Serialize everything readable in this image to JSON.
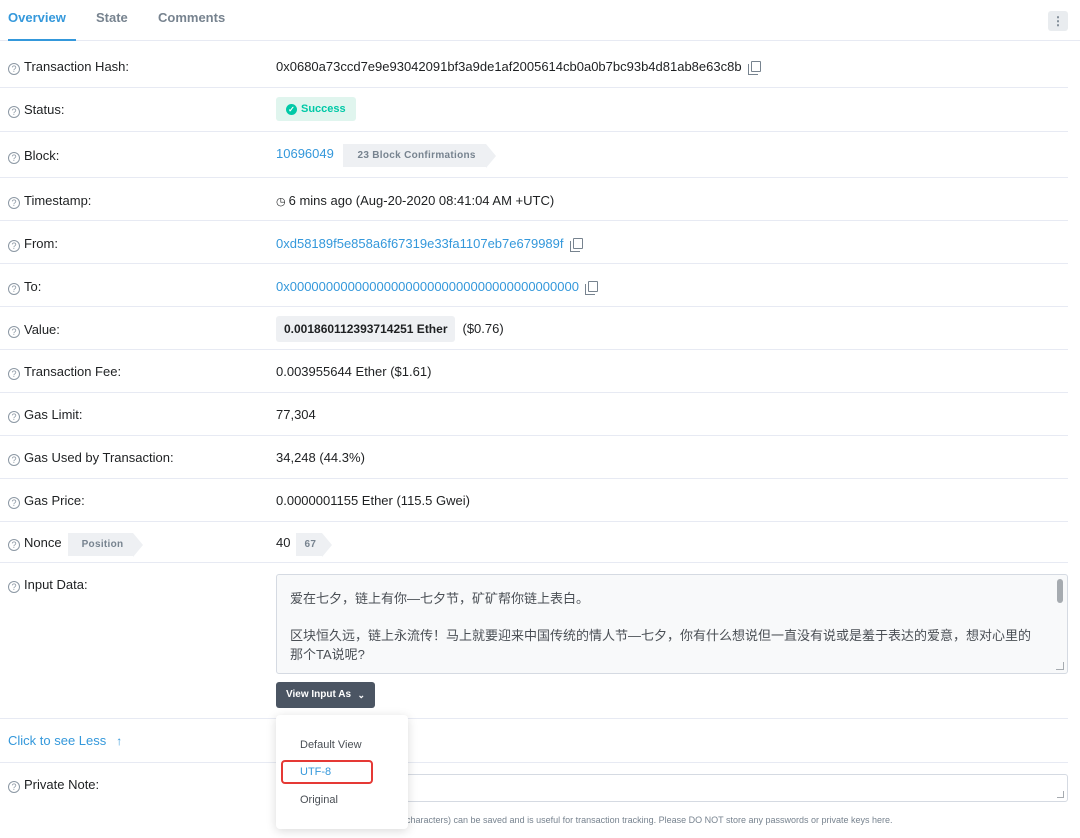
{
  "tabs": {
    "overview": "Overview",
    "state": "State",
    "comments": "Comments",
    "more": "⋮"
  },
  "rows": {
    "hash": {
      "label": "Transaction Hash:",
      "value": "0x0680a73ccd7e9e93042091bf3a9de1af2005614cb0a0b7bc93b4d81ab8e63c8b"
    },
    "status": {
      "label": "Status:",
      "value": "Success"
    },
    "block": {
      "label": "Block:",
      "value": "10696049",
      "confirmations": "23 Block Confirmations"
    },
    "timestamp": {
      "label": "Timestamp:",
      "value": "6 mins ago (Aug-20-2020 08:41:04 AM +UTC)"
    },
    "from": {
      "label": "From:",
      "value": "0xd58189f5e858a6f67319e33fa1107eb7e679989f"
    },
    "to": {
      "label": "To:",
      "value": "0x0000000000000000000000000000000000000000"
    },
    "value": {
      "label": "Value:",
      "amount": "0.001860112393714251 Ether",
      "usd": "($0.76)"
    },
    "fee": {
      "label": "Transaction Fee:",
      "value": "0.003955644 Ether ($1.61)"
    },
    "gas_limit": {
      "label": "Gas Limit:",
      "value": "77,304"
    },
    "gas_used": {
      "label": "Gas Used by Transaction:",
      "value": "34,248 (44.3%)"
    },
    "gas_price": {
      "label": "Gas Price:",
      "value": "0.0000001155 Ether (115.5 Gwei)"
    },
    "nonce": {
      "label": "Nonce",
      "position_tag": "Position",
      "value": "40",
      "position": "67"
    },
    "input": {
      "label": "Input Data:",
      "line1": "爱在七夕，链上有你—七夕节，矿矿帮你链上表白。",
      "line2": "区块恒久远，链上永流传！马上就要迎来中国传统的情人节—七夕，你有什么想说但一直没有说或是羞于表达的爱意，想对心里的那个TA说呢?"
    }
  },
  "view_input": {
    "button": "View Input As",
    "options": [
      "Default View",
      "UTF-8",
      "Original"
    ],
    "selected": "UTF-8"
  },
  "see_less": "Click to see Less",
  "private_note": {
    "label": "Private Note:",
    "hint": "characters) can be saved and is useful for transaction tracking. Please DO NOT store any passwords or private keys here."
  },
  "colors": {
    "accent": "#3498db",
    "success": "#00c9a7",
    "highlight": "#e53935"
  }
}
